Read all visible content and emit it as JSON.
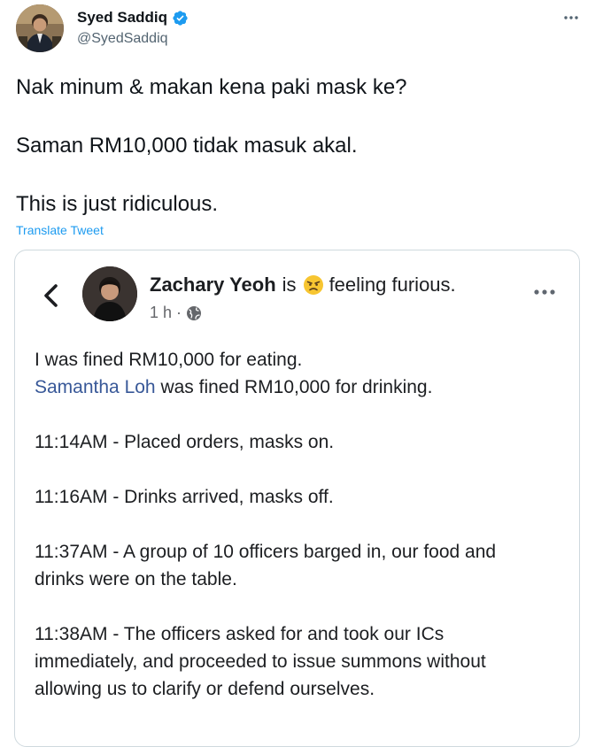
{
  "tweet": {
    "author": {
      "display_name": "Syed Saddiq",
      "handle": "@SyedSaddiq",
      "verified_icon": "verified-badge-icon",
      "avatar_icon": "profile-photo"
    },
    "more_icon": "more-horizontal-icon",
    "text": {
      "line1": "Nak minum & makan kena paki mask ke?",
      "line2": "Saman RM10,000 tidak masuk akal.",
      "line3": "This is just ridiculous."
    },
    "translate_label": "Translate Tweet",
    "accent_color": "#1d9bf0"
  },
  "embedded_post": {
    "back_icon": "chevron-left-icon",
    "author": "Zachary Yeoh",
    "is_text": "is",
    "feeling_emoji": "furious-face-emoji",
    "feeling_text": "feeling furious.",
    "time": "1 h",
    "time_separator": "·",
    "audience_icon": "globe-icon",
    "more_icon": "more-horizontal-icon",
    "body": {
      "p1_line1": "I was fined RM10,000 for eating.",
      "p1_mention": "Samantha Loh",
      "p1_line2_rest": " was fined RM10,000 for drinking.",
      "p2": "11:14AM - Placed orders, masks on.",
      "p3": "11:16AM - Drinks arrived, masks off.",
      "p4_line1": "11:37AM - A group of 10 officers barged in, our food and",
      "p4_line2": "drinks were on the table.",
      "p5_line1": "11:38AM - The officers asked for and took our ICs",
      "p5_line2": "immediately, and proceeded to issue summons without",
      "p5_line3": "allowing us to clarify or defend ourselves."
    },
    "mention_color": "#385898"
  }
}
